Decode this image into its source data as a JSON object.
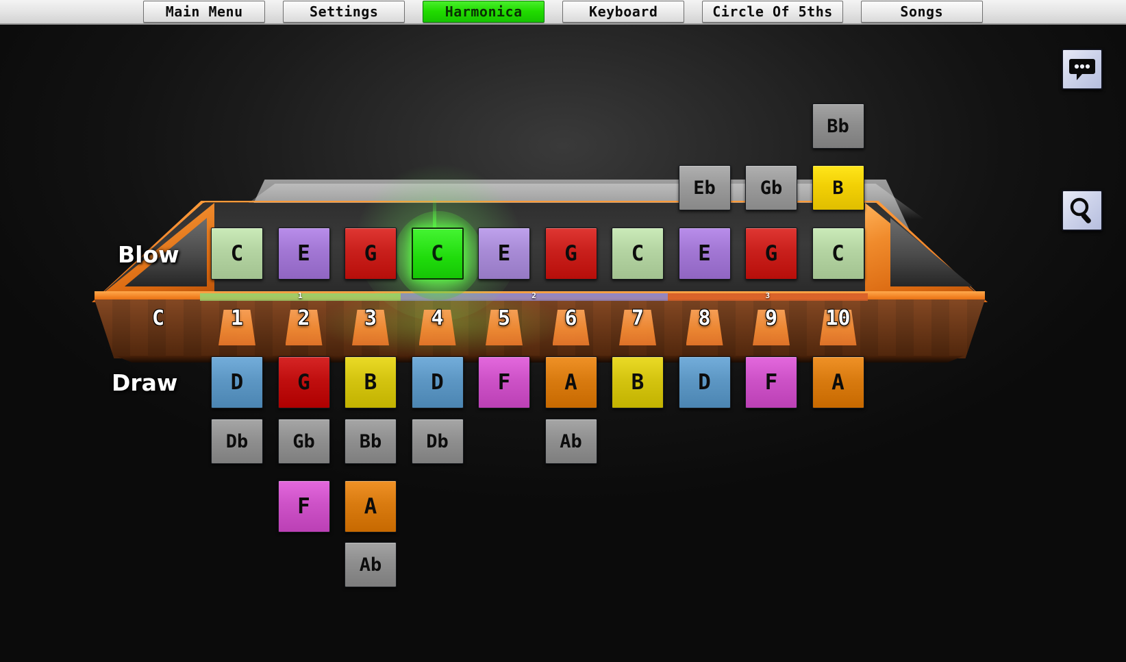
{
  "nav": {
    "items": [
      {
        "label": "Main Menu",
        "active": false
      },
      {
        "label": "Settings",
        "active": false
      },
      {
        "label": "Harmonica",
        "active": true
      },
      {
        "label": "Keyboard",
        "active": false
      },
      {
        "label": "Circle Of 5ths",
        "active": false
      },
      {
        "label": "Songs",
        "active": false
      }
    ],
    "active_color": "#21db00"
  },
  "side_icons": [
    {
      "name": "chat-icon",
      "label": "Chat"
    },
    {
      "name": "search-icon",
      "label": "Search"
    }
  ],
  "labels": {
    "blow": "Blow",
    "draw": "Draw",
    "key": "C"
  },
  "hole_numbers": [
    "1",
    "2",
    "3",
    "4",
    "5",
    "6",
    "7",
    "8",
    "9",
    "10"
  ],
  "octave_markers": [
    {
      "label": "1",
      "color": "#9ccf6a",
      "start": 0,
      "span": 3
    },
    {
      "label": "2",
      "color": "#8f86c9",
      "start": 3,
      "span": 4
    },
    {
      "label": "3",
      "color": "#d8602a",
      "start": 7,
      "span": 3
    }
  ],
  "note_colors": {
    "C": "#b4d4a2",
    "Db": "#909090",
    "D": "#5d97c4",
    "Eb": "#9a9a9a",
    "E": "#a277d4",
    "F": "#cd52c7",
    "Gb": "#9a9a9a",
    "G": "#c9201c",
    "Ab": "#8e8e8e",
    "A": "#d97b10",
    "Bb": "#8e8e8e",
    "B": "#d4c410",
    "B_bright": "#f2d005",
    "highlight": "#21db00"
  },
  "rows": {
    "overblow_2": [
      null,
      null,
      null,
      null,
      null,
      null,
      null,
      null,
      null,
      {
        "note": "Bb",
        "color": "#8e8e8e"
      }
    ],
    "overblow_1": [
      null,
      null,
      null,
      null,
      null,
      null,
      null,
      {
        "note": "Eb",
        "color": "#9a9a9a"
      },
      {
        "note": "Gb",
        "color": "#9a9a9a"
      },
      {
        "note": "B",
        "color": "#f2d005"
      }
    ],
    "blow": [
      {
        "note": "C",
        "color": "#b4d4a2"
      },
      {
        "note": "E",
        "color": "#a277d4"
      },
      {
        "note": "G",
        "color": "#c9201c"
      },
      {
        "note": "C",
        "color": "#21db00",
        "highlighted": true
      },
      {
        "note": "E",
        "color": "#a88bd6"
      },
      {
        "note": "G",
        "color": "#c9201c"
      },
      {
        "note": "C",
        "color": "#b4d4a2"
      },
      {
        "note": "E",
        "color": "#a277d4"
      },
      {
        "note": "G",
        "color": "#c9201c"
      },
      {
        "note": "C",
        "color": "#b4d4a2"
      }
    ],
    "draw": [
      {
        "note": "D",
        "color": "#5d97c4"
      },
      {
        "note": "G",
        "color": "#c00f0f"
      },
      {
        "note": "B",
        "color": "#d4c410"
      },
      {
        "note": "D",
        "color": "#5d97c4"
      },
      {
        "note": "F",
        "color": "#cd52c7"
      },
      {
        "note": "A",
        "color": "#d97b10"
      },
      {
        "note": "B",
        "color": "#d4c410"
      },
      {
        "note": "D",
        "color": "#5d97c4"
      },
      {
        "note": "F",
        "color": "#cd52c7"
      },
      {
        "note": "A",
        "color": "#d97b10"
      }
    ],
    "bend_1": [
      {
        "note": "Db",
        "color": "#909090"
      },
      {
        "note": "Gb",
        "color": "#909090"
      },
      {
        "note": "Bb",
        "color": "#909090"
      },
      {
        "note": "Db",
        "color": "#909090"
      },
      null,
      {
        "note": "Ab",
        "color": "#909090"
      },
      null,
      null,
      null,
      null
    ],
    "bend_2": [
      null,
      {
        "note": "F",
        "color": "#cd52c7"
      },
      {
        "note": "A",
        "color": "#d97b10"
      },
      null,
      null,
      null,
      null,
      null,
      null,
      null
    ],
    "bend_3": [
      null,
      null,
      {
        "note": "Ab",
        "color": "#8e8e8e"
      },
      null,
      null,
      null,
      null,
      null,
      null,
      null
    ]
  }
}
